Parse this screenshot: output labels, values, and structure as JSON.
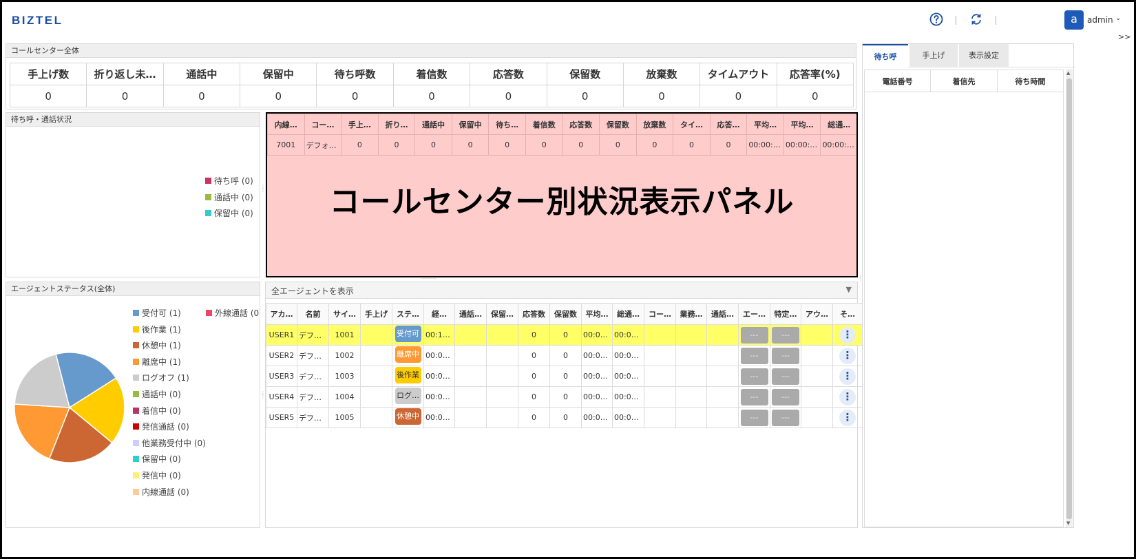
{
  "header": {
    "logo": "BIZTEL",
    "user_initial": "a",
    "user_name": "admin",
    "caret": "⌄",
    "collapse": ">>"
  },
  "colors": {
    "brand": "#1a4ea3",
    "highlight_row": "#ffff66",
    "cc_panel_bg": "#ffcccc"
  },
  "summary": {
    "title": "コールセンター全体",
    "headers": [
      "手上げ数",
      "折り返し未…",
      "通話中",
      "保留中",
      "待ち呼数",
      "着信数",
      "応答数",
      "保留数",
      "放棄数",
      "タイムアウト",
      "応答率(%)"
    ],
    "values": [
      "0",
      "0",
      "0",
      "0",
      "0",
      "0",
      "0",
      "0",
      "0",
      "0",
      "0"
    ]
  },
  "waiting": {
    "title": "待ち呼・通話状況",
    "legend": [
      {
        "label": "待ち呼 (0)",
        "color": "#cc3366"
      },
      {
        "label": "通話中 (0)",
        "color": "#99bb44"
      },
      {
        "label": "保留中 (0)",
        "color": "#33cccc"
      }
    ]
  },
  "callcenter": {
    "headers": [
      "内線…",
      "コー…",
      "手上…",
      "折り…",
      "通話中",
      "保留中",
      "待ち…",
      "着信数",
      "応答数",
      "保留数",
      "放棄数",
      "タイ…",
      "応答…",
      "平均…",
      "平均…",
      "総通…"
    ],
    "row": [
      "7001",
      "デフォル…",
      "0",
      "0",
      "0",
      "0",
      "0",
      "0",
      "0",
      "0",
      "0",
      "0",
      "0",
      "00:00:00",
      "00:00:00",
      "00:00:00"
    ],
    "overlay": "コールセンター別状況表示パネル"
  },
  "agent_status": {
    "title": "エージェントステータス(全体)",
    "legend": [
      {
        "label": "受付可 (1)",
        "color": "#6699cc"
      },
      {
        "label": "後作業 (1)",
        "color": "#ffcc00"
      },
      {
        "label": "休憩中 (1)",
        "color": "#cc6633"
      },
      {
        "label": "離席中 (1)",
        "color": "#ff9933"
      },
      {
        "label": "ログオフ (1)",
        "color": "#cccccc"
      },
      {
        "label": "通話中 (0)",
        "color": "#99bb44"
      },
      {
        "label": "着信中 (0)",
        "color": "#bb3366"
      },
      {
        "label": "発信通話 (0)",
        "color": "#cc0000"
      },
      {
        "label": "他業務受付中 (0)",
        "color": "#ccccff"
      },
      {
        "label": "保留中 (0)",
        "color": "#33cccc"
      },
      {
        "label": "発信中 (0)",
        "color": "#ffee77"
      },
      {
        "label": "内線通話 (0)",
        "color": "#ffcc99"
      }
    ],
    "legend_extra": {
      "label": "外線通話 (0",
      "color": "#ee4466"
    },
    "pie": [
      {
        "label": "受付可",
        "value": 1,
        "color": "#6699cc"
      },
      {
        "label": "後作業",
        "value": 1,
        "color": "#ffcc00"
      },
      {
        "label": "休憩中",
        "value": 1,
        "color": "#cc6633"
      },
      {
        "label": "離席中",
        "value": 1,
        "color": "#ff9933"
      },
      {
        "label": "ログオフ",
        "value": 1,
        "color": "#cccccc"
      }
    ]
  },
  "agents": {
    "filter_label": "全エージェントを表示",
    "filter_arrow": "▼",
    "headers": [
      "アカ…",
      "名前",
      "サイ…",
      "手上げ",
      "ステ…",
      "経…",
      "通話…",
      "保留…",
      "応答数",
      "保留数",
      "平均…",
      "総通…",
      "コー…",
      "業務…",
      "通話…",
      "エー…",
      "特定…",
      "アウ…",
      "そ…"
    ],
    "btn_text": "---",
    "menu_glyph": "⋮",
    "rows": [
      {
        "account": "USER1",
        "name": "デフォ…",
        "site": "1001",
        "status": "受付可",
        "status_color": "#6699cc",
        "elapsed": "00:18…",
        "answered": "0",
        "held": "0",
        "avg": "00:00…",
        "total": "00:00…",
        "highlight": true
      },
      {
        "account": "USER2",
        "name": "デフォ…",
        "site": "1002",
        "status": "離席中",
        "status_color": "#ff9933",
        "elapsed": "00:00…",
        "answered": "0",
        "held": "0",
        "avg": "00:00…",
        "total": "00:00…",
        "highlight": false
      },
      {
        "account": "USER3",
        "name": "デフォ…",
        "site": "1003",
        "status": "後作業",
        "status_color": "#ffcc00",
        "elapsed": "00:00…",
        "answered": "0",
        "held": "0",
        "avg": "00:00…",
        "total": "00:00…",
        "highlight": false
      },
      {
        "account": "USER4",
        "name": "デフォ…",
        "site": "1004",
        "status": "ログ…",
        "status_color": "#cccccc",
        "elapsed": "00:00…",
        "answered": "0",
        "held": "0",
        "avg": "00:00…",
        "total": "00:00…",
        "highlight": false
      },
      {
        "account": "USER5",
        "name": "デフォ…",
        "site": "1005",
        "status": "休憩中",
        "status_color": "#cc6633",
        "elapsed": "00:01…",
        "answered": "0",
        "held": "0",
        "avg": "00:00…",
        "total": "00:00…",
        "highlight": false
      }
    ]
  },
  "right_panel": {
    "tabs": [
      "待ち呼",
      "手上げ",
      "表示設定"
    ],
    "queue_headers": [
      "電話番号",
      "着信先",
      "待ち時間"
    ]
  }
}
